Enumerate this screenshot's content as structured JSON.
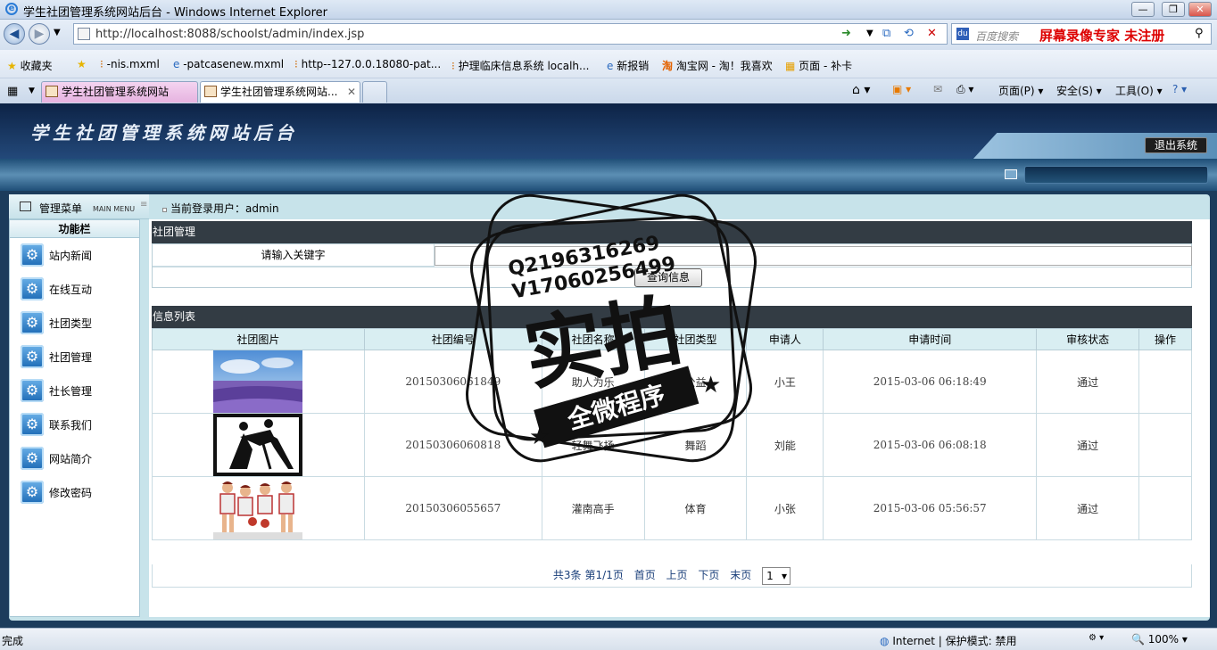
{
  "window": {
    "title": "学生社团管理系统网站后台 - Windows Internet Explorer"
  },
  "address": {
    "url": "http://localhost:8088/schoolst/admin/index.jsp",
    "search_placeholder": "百度搜索",
    "watermark_text": "屏幕录像专家  未注册"
  },
  "favorites": {
    "label": "收藏夹",
    "items": [
      "-nis.mxml",
      "-patcasenew.mxml",
      "http--127.0.0.18080-pat...",
      "护理临床信息系统 localh...",
      "新报销",
      "淘宝网 - 淘！我喜欢",
      "页面 - 补卡"
    ]
  },
  "tabs": [
    {
      "label": "学生社团管理系统网站"
    },
    {
      "label": "学生社团管理系统网站..."
    }
  ],
  "commands": {
    "page": "页面(P)",
    "safety": "安全(S)",
    "tools": "工具(O)"
  },
  "banner": {
    "title": "学生社团管理系统网站后台",
    "logout": "退出系统"
  },
  "sidebar": {
    "header": "管理菜单",
    "header_sub": "MAIN MENU",
    "section": "功能栏",
    "items": [
      {
        "label": "站内新闻"
      },
      {
        "label": "在线互动"
      },
      {
        "label": "社团类型"
      },
      {
        "label": "社团管理"
      },
      {
        "label": "社长管理"
      },
      {
        "label": "联系我们"
      },
      {
        "label": "网站简介"
      },
      {
        "label": "修改密码"
      }
    ]
  },
  "user": {
    "line": "当前登录用户：admin"
  },
  "manage": {
    "title": "社团管理",
    "keyword_label": "请输入关键字",
    "keyword_value": "",
    "query_button": "查询信息"
  },
  "list": {
    "title": "信息列表",
    "columns": [
      "社团图片",
      "社团编号",
      "社团名称",
      "社团类型",
      "申请人",
      "申请时间",
      "审核状态",
      "操作"
    ],
    "rows": [
      {
        "image": "lavender-field",
        "code": "20150306061849",
        "name": "助人为乐",
        "type": "公益",
        "applicant": "小王",
        "time": "2015-03-06 06:18:49",
        "status": "通过",
        "op": ""
      },
      {
        "image": "dancers-silhouette",
        "code": "20150306060818",
        "name": "轻舞飞扬",
        "type": "舞蹈",
        "applicant": "刘能",
        "time": "2015-03-06 06:08:18",
        "status": "通过",
        "op": ""
      },
      {
        "image": "basketball-team",
        "code": "20150306055657",
        "name": "灌南高手",
        "type": "体育",
        "applicant": "小张",
        "time": "2015-03-06 05:56:57",
        "status": "通过",
        "op": ""
      }
    ]
  },
  "pager": {
    "total": "共3条",
    "page": "第1/1页",
    "first": "首页",
    "prev": "上页",
    "next": "下页",
    "last": "末页",
    "select": "1"
  },
  "stamp": {
    "line1": "Q2196316269",
    "line2": "V17060256499",
    "big": "实拍",
    "banner": "全微程序"
  },
  "status": {
    "left": "完成",
    "zone": "Internet | 保护模式: 禁用",
    "zoom": "100%"
  }
}
